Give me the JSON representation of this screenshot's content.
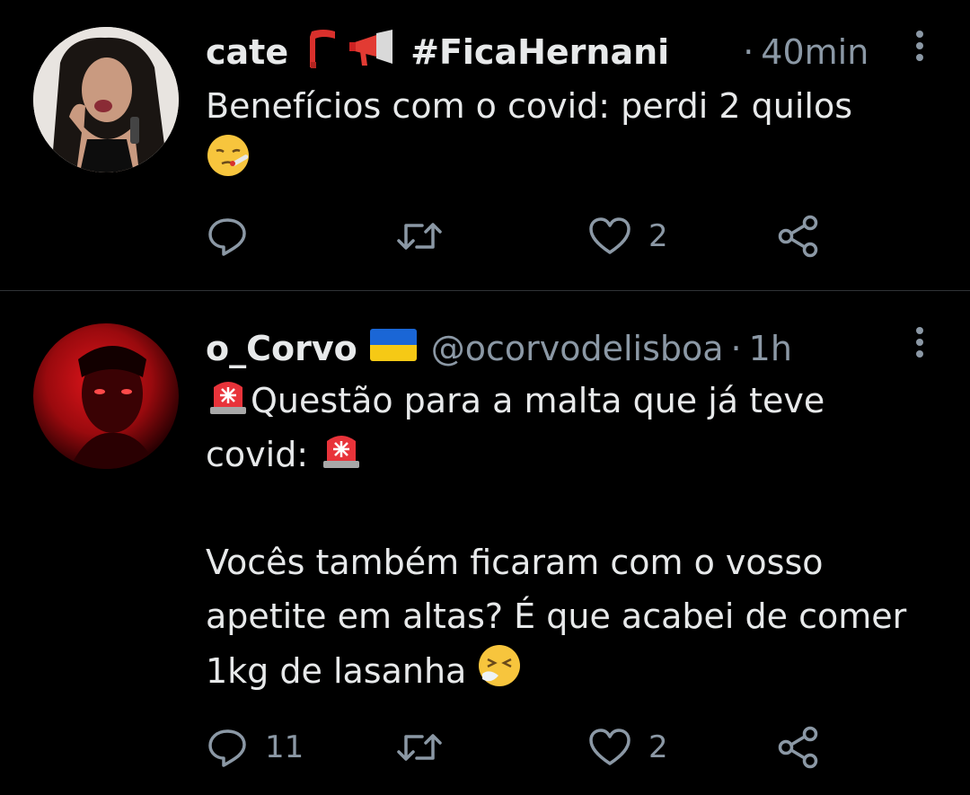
{
  "colors": {
    "background": "#000000",
    "text": "#e7e9ea",
    "muted": "#8b98a5",
    "divider": "#2f3336"
  },
  "tweets": [
    {
      "name": "cate",
      "name_emojis": [
        "scarf-icon",
        "megaphone-icon"
      ],
      "hashtag": "#FicaHernani",
      "dot": "·",
      "time": "40min",
      "lines": [
        "Benefícios com o covid: perdi 2 quilos"
      ],
      "trailing_emoji": "face-with-thermometer-icon",
      "actions": {
        "reply_count": "",
        "retweet_count": "",
        "like_count": "2"
      }
    },
    {
      "name": "o_Corvo",
      "name_emojis": [
        "ukraine-flag-icon"
      ],
      "handle": "@ocorvodelisboa",
      "dot": "·",
      "time": "1h",
      "line1": "Questão para a malta que já teve",
      "line2": "covid:",
      "line3": "Vocês também ficaram com o vosso",
      "line4": "apetite em altas? É que acabei de comer",
      "line5": "1kg de lasanha",
      "actions": {
        "reply_count": "11",
        "retweet_count": "",
        "like_count": "2"
      }
    }
  ]
}
